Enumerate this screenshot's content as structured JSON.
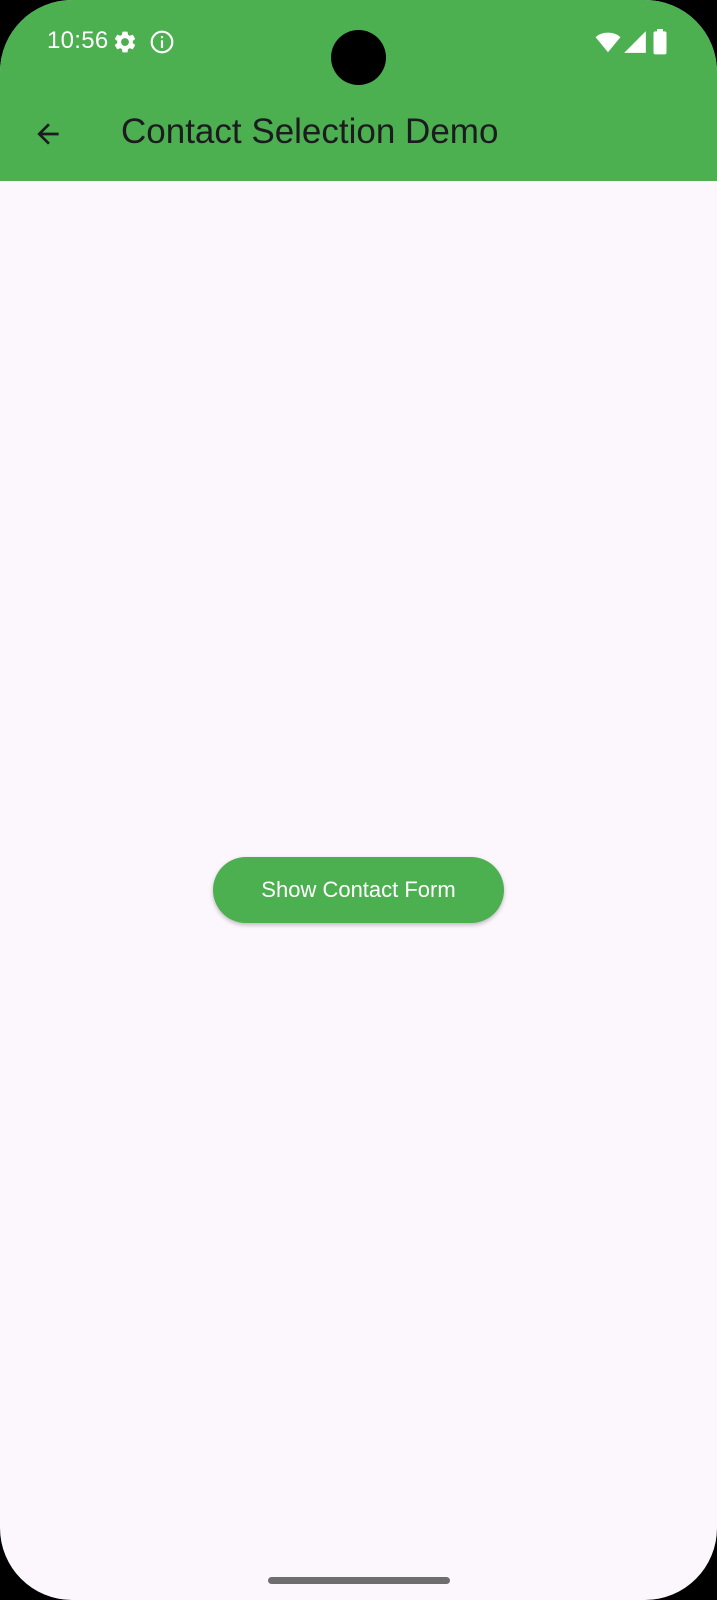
{
  "status_bar": {
    "time": "10:56",
    "left_icons": [
      "settings-icon",
      "info-icon"
    ],
    "right_icons": [
      "wifi-icon",
      "cellular-signal-icon",
      "battery-icon"
    ]
  },
  "app_bar": {
    "title": "Contact Selection Demo",
    "back_icon": "arrow-back-icon",
    "background_color": "#4caf50"
  },
  "main": {
    "button_label": "Show Contact Form",
    "button_color": "#4caf50",
    "background_color": "#fcf6fd"
  }
}
